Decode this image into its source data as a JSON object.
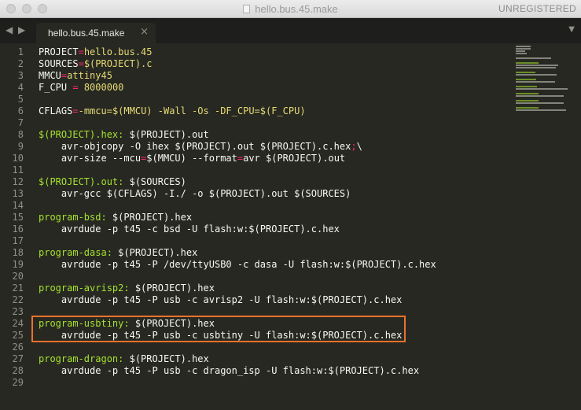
{
  "window": {
    "title": "hello.bus.45.make",
    "status": "UNREGISTERED"
  },
  "tab": {
    "label": "hello.bus.45.make"
  },
  "icons": {
    "nav_left": "chevron-left-icon",
    "nav_right": "chevron-right-icon",
    "tab_close": "close-icon",
    "tab_dropdown": "chevron-down-icon",
    "file": "document-icon"
  },
  "colors": {
    "editor_bg": "#272822",
    "target": "#a6e22e",
    "operator": "#f92672",
    "value": "#e6db74",
    "number": "#ae81ff",
    "highlight_border": "#e8732c"
  },
  "line_numbers": [
    "1",
    "2",
    "3",
    "4",
    "5",
    "6",
    "7",
    "8",
    "9",
    "10",
    "11",
    "12",
    "13",
    "14",
    "15",
    "16",
    "17",
    "18",
    "19",
    "20",
    "21",
    "22",
    "23",
    "24",
    "25",
    "26",
    "27",
    "28",
    "29"
  ],
  "lines": [
    [
      {
        "t": "PROJECT",
        "c": "wh"
      },
      {
        "t": "=",
        "c": "pk"
      },
      {
        "t": "hello.bus.45",
        "c": "yl"
      }
    ],
    [
      {
        "t": "SOURCES",
        "c": "wh"
      },
      {
        "t": "=",
        "c": "pk"
      },
      {
        "t": "$(PROJECT).c",
        "c": "yl"
      }
    ],
    [
      {
        "t": "MMCU",
        "c": "wh"
      },
      {
        "t": "=",
        "c": "pk"
      },
      {
        "t": "attiny45",
        "c": "yl"
      }
    ],
    [
      {
        "t": "F_CPU ",
        "c": "wh"
      },
      {
        "t": "=",
        "c": "pk"
      },
      {
        "t": " 8000000",
        "c": "yl"
      }
    ],
    [],
    [
      {
        "t": "CFLAGS",
        "c": "wh"
      },
      {
        "t": "=",
        "c": "pk"
      },
      {
        "t": "-mmcu=$(MMCU) -Wall -Os -DF_CPU=$(F_CPU)",
        "c": "yl"
      }
    ],
    [],
    [
      {
        "t": "$(PROJECT).hex:",
        "c": "gr"
      },
      {
        "t": " $(PROJECT).out",
        "c": "wh"
      }
    ],
    [
      {
        "t": "    avr-objcopy -O ihex $(PROJECT).out $(PROJECT).c.hex",
        "c": "wh"
      },
      {
        "t": ";",
        "c": "pk"
      },
      {
        "t": "\\",
        "c": "wh"
      }
    ],
    [
      {
        "t": "    avr-size --mcu",
        "c": "wh"
      },
      {
        "t": "=",
        "c": "pk"
      },
      {
        "t": "$(MMCU) --format",
        "c": "wh"
      },
      {
        "t": "=",
        "c": "pk"
      },
      {
        "t": "avr $(PROJECT).out",
        "c": "wh"
      }
    ],
    [],
    [
      {
        "t": "$(PROJECT).out:",
        "c": "gr"
      },
      {
        "t": " $(SOURCES)",
        "c": "wh"
      }
    ],
    [
      {
        "t": "    avr-gcc $(CFLAGS) -I./ -o $(PROJECT).out $(SOURCES)",
        "c": "wh"
      }
    ],
    [],
    [
      {
        "t": "program-bsd:",
        "c": "gr"
      },
      {
        "t": " $(PROJECT).hex",
        "c": "wh"
      }
    ],
    [
      {
        "t": "    avrdude -p t45 -c bsd -U flash:w:$(PROJECT).c.hex",
        "c": "wh"
      }
    ],
    [],
    [
      {
        "t": "program-dasa:",
        "c": "gr"
      },
      {
        "t": " $(PROJECT).hex",
        "c": "wh"
      }
    ],
    [
      {
        "t": "    avrdude -p t45 -P /dev/ttyUSB0 -c dasa -U flash:w:$(PROJECT).c.hex",
        "c": "wh"
      }
    ],
    [],
    [
      {
        "t": "program-avrisp2:",
        "c": "gr"
      },
      {
        "t": " $(PROJECT).hex",
        "c": "wh"
      }
    ],
    [
      {
        "t": "    avrdude -p t45 -P usb -c avrisp2 -U flash:w:$(PROJECT).c.hex",
        "c": "wh"
      }
    ],
    [],
    [
      {
        "t": "program-usbtiny:",
        "c": "gr"
      },
      {
        "t": " $(PROJECT).hex",
        "c": "wh"
      }
    ],
    [
      {
        "t": "    avrdude -p t45 -P usb -c usbtiny -U flash:w:$(PROJECT).c.hex",
        "c": "wh"
      }
    ],
    [],
    [
      {
        "t": "program-dragon:",
        "c": "gr"
      },
      {
        "t": " $(PROJECT).hex",
        "c": "wh"
      }
    ],
    [
      {
        "t": "    avrdude -p t45 -P usb -c dragon_isp -U flash:w:$(PROJECT).c.hex",
        "c": "wh"
      }
    ],
    []
  ]
}
